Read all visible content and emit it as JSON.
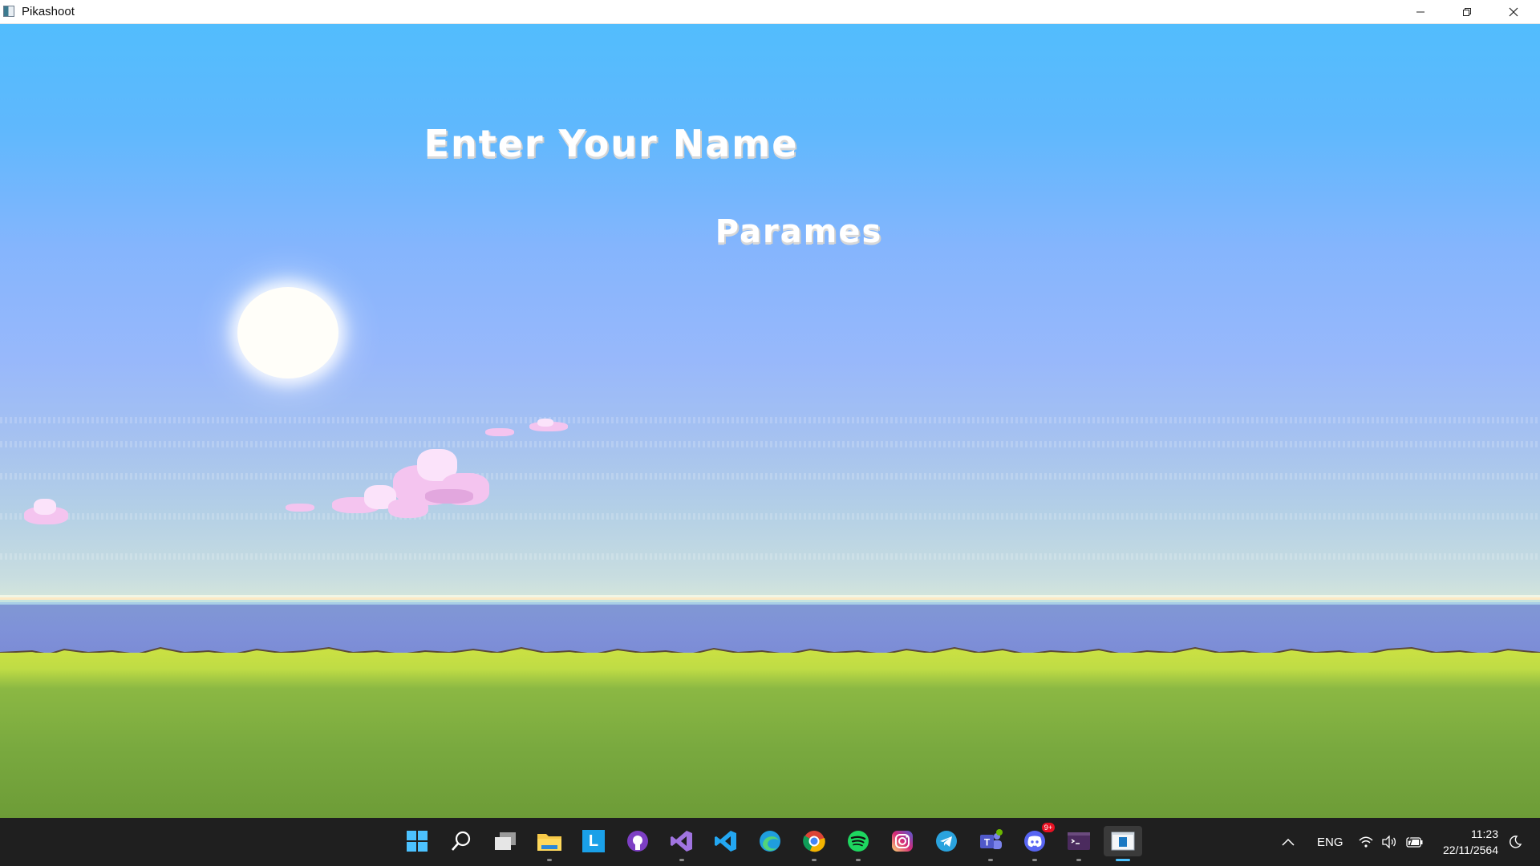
{
  "window": {
    "title": "Pikashoot",
    "icon": "app-window-icon",
    "controls": [
      "minimize-icon",
      "restore-icon",
      "close-icon"
    ]
  },
  "game": {
    "heading": "Enter Your Name",
    "name_value": "Parames"
  },
  "taskbar": {
    "apps": [
      {
        "name": "start",
        "icon": "windows-logo-icon"
      },
      {
        "name": "search",
        "icon": "search-icon"
      },
      {
        "name": "task-view",
        "icon": "task-view-icon"
      },
      {
        "name": "file-explorer",
        "icon": "folder-icon"
      },
      {
        "name": "l-app",
        "icon": "l-app-icon",
        "label": "L"
      },
      {
        "name": "github-desktop",
        "icon": "github-icon"
      },
      {
        "name": "visual-studio",
        "icon": "visual-studio-icon"
      },
      {
        "name": "vscode",
        "icon": "vscode-icon"
      },
      {
        "name": "edge",
        "icon": "edge-icon"
      },
      {
        "name": "chrome",
        "icon": "chrome-icon"
      },
      {
        "name": "spotify",
        "icon": "spotify-icon"
      },
      {
        "name": "instagram",
        "icon": "instagram-icon"
      },
      {
        "name": "telegram",
        "icon": "telegram-icon"
      },
      {
        "name": "teams",
        "icon": "teams-icon"
      },
      {
        "name": "discord",
        "icon": "discord-icon",
        "badge": "9+"
      },
      {
        "name": "terminal",
        "icon": "terminal-icon"
      },
      {
        "name": "pikashoot",
        "icon": "pikashoot-app-icon"
      }
    ],
    "tray": {
      "language": "ENG",
      "time": "11:23",
      "date": "22/11/2564"
    }
  },
  "colors": {
    "sky_top": "#52bdfd",
    "sky_bottom": "#d2e4dc",
    "sea": "#7f92d8",
    "grass_light": "#c9e043",
    "grass_dark": "#6d9c37",
    "cloud": "#f4c4ef",
    "taskbar": "#1f1f1f",
    "accent": "#4cc2ff"
  }
}
